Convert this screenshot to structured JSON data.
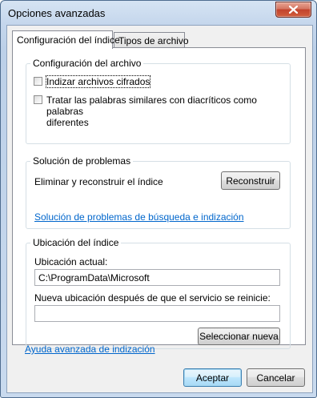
{
  "window": {
    "title": "Opciones avanzadas"
  },
  "tabs": [
    {
      "label": "Configuración del índice",
      "active": true
    },
    {
      "label": "Tipos de archivo",
      "active": false
    }
  ],
  "file_settings": {
    "title": "Configuración del archivo",
    "options": [
      {
        "label": "Indizar archivos cifrados",
        "checked": false
      },
      {
        "label_line1": "Tratar las palabras similares con diacríticos como palabras",
        "label_line2": "diferentes",
        "checked": false
      }
    ]
  },
  "troubleshooting": {
    "title": "Solución de problemas",
    "rebuild_text": "Eliminar y reconstruir el índice",
    "rebuild_button": "Reconstruir",
    "link": "Solución de problemas de búsqueda e indización"
  },
  "index_location": {
    "title": "Ubicación del índice",
    "current_label": "Ubicación actual:",
    "current_value": "C:\\ProgramData\\Microsoft",
    "new_label": "Nueva ubicación después de que el servicio se reinicie:",
    "new_value": "",
    "select_button": "Seleccionar nueva"
  },
  "help_link": "Ayuda avanzada de indización",
  "footer": {
    "accept": "Aceptar",
    "cancel": "Cancelar"
  },
  "icons": {
    "close": "close-icon"
  }
}
